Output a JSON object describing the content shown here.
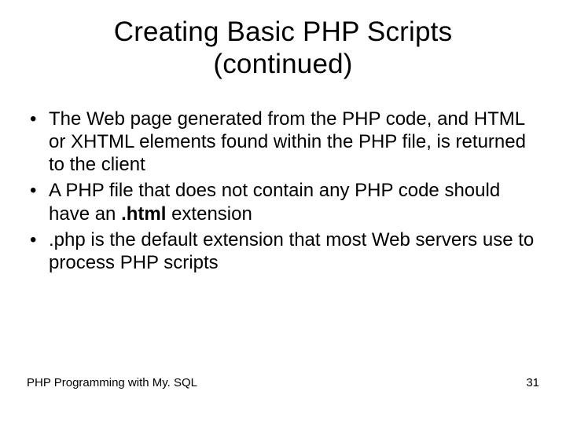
{
  "title_line1": "Creating Basic PHP Scripts",
  "title_line2": "(continued)",
  "bullets": {
    "b1": "The Web page generated from the PHP code, and HTML or XHTML elements found within the PHP file, is returned to the client",
    "b2_pre": "A PHP file that does not contain any PHP code should have an ",
    "b2_bold": ".html",
    "b2_post": " extension",
    "b3": ".php is the default extension that most Web servers use to process PHP scripts"
  },
  "footer": {
    "left": "PHP Programming with My. SQL",
    "right": "31"
  }
}
